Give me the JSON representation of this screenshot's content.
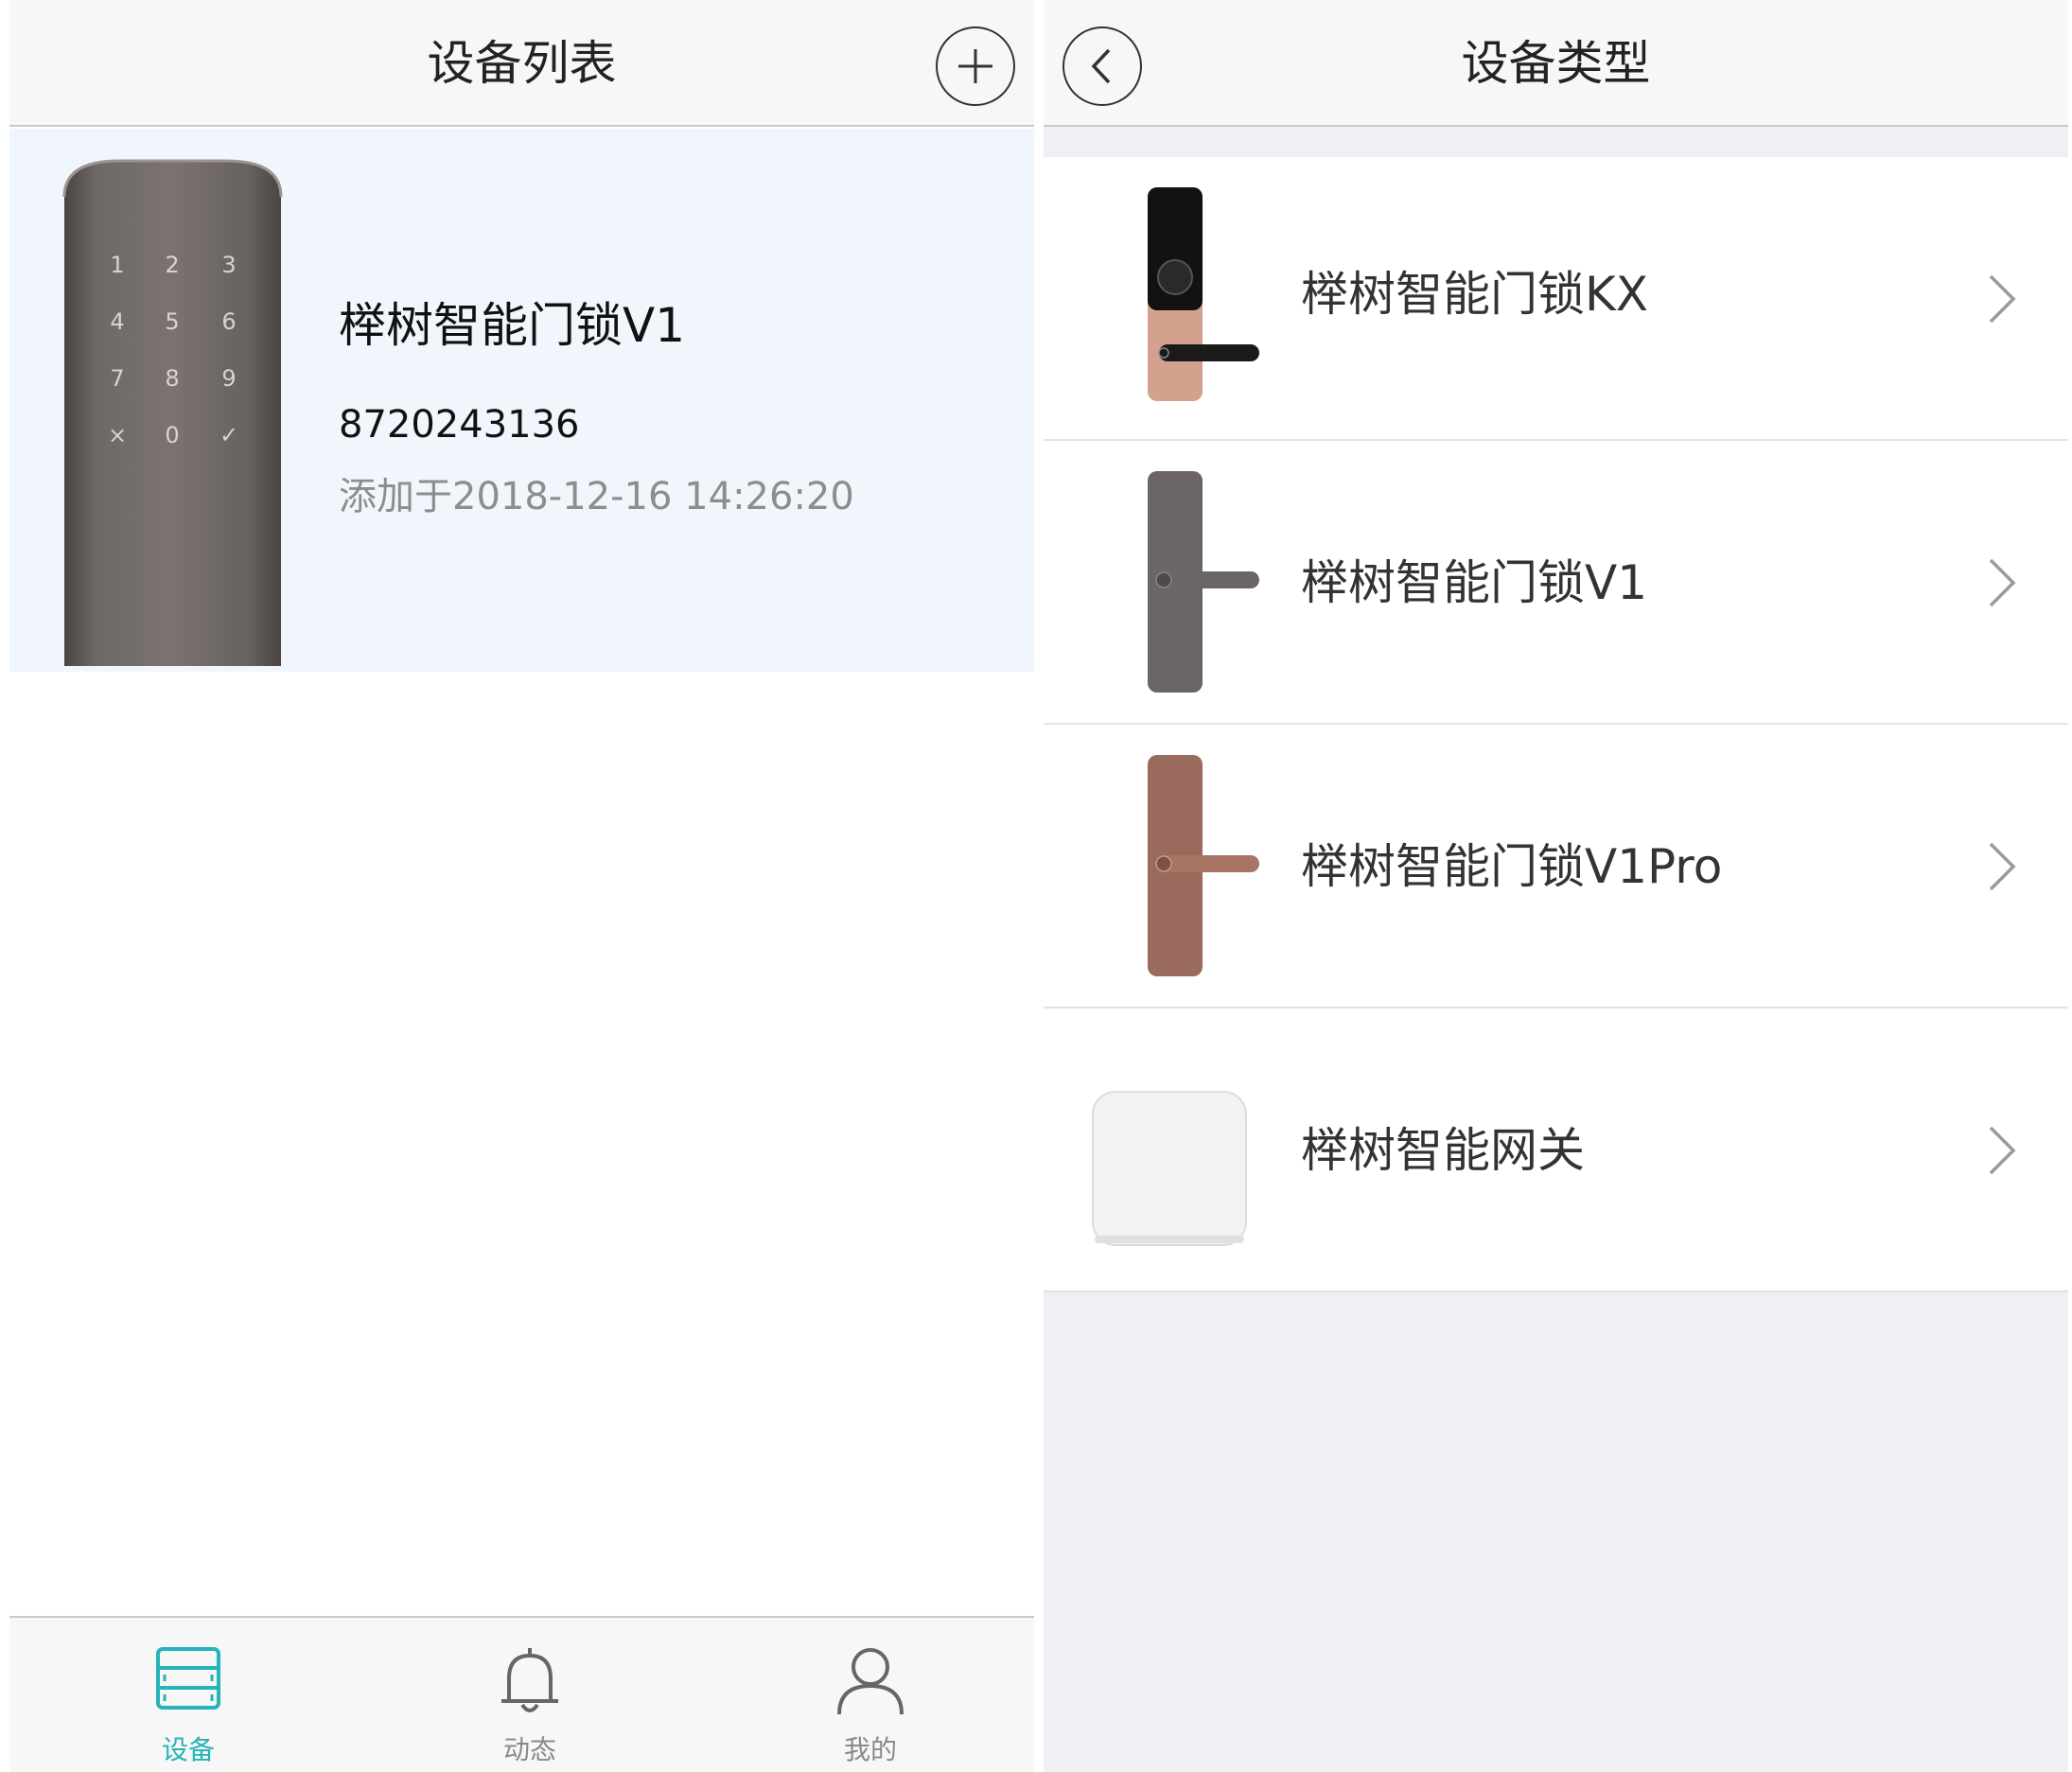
{
  "left": {
    "title": "设备列表",
    "device": {
      "name": "榉树智能门锁V1",
      "serial": "8720243136",
      "added": "添加于2018-12-16 14:26:20",
      "keypad": [
        "1",
        "2",
        "3",
        "4",
        "5",
        "6",
        "7",
        "8",
        "9",
        "×",
        "0",
        "✓"
      ]
    },
    "tabs": [
      {
        "label": "设备",
        "icon": "device-list-icon",
        "active": true
      },
      {
        "label": "动态",
        "icon": "bell-icon",
        "active": false
      },
      {
        "label": "我的",
        "icon": "person-icon",
        "active": false
      }
    ]
  },
  "right": {
    "title": "设备类型",
    "types": [
      {
        "label": "榉树智能门锁KX",
        "thumb": "lock-kx-thumbnail"
      },
      {
        "label": "榉树智能门锁V1",
        "thumb": "lock-v1-thumbnail"
      },
      {
        "label": "榉树智能门锁V1Pro",
        "thumb": "lock-v1pro-thumbnail"
      },
      {
        "label": "榉树智能网关",
        "thumb": "gateway-thumbnail"
      }
    ]
  },
  "colors": {
    "accent": "#26b3b9",
    "card_background": "#f1f6fd",
    "navbar_background": "#f7f7f7",
    "list_background": "#efeff4",
    "muted_text": "#8d8d8d"
  }
}
